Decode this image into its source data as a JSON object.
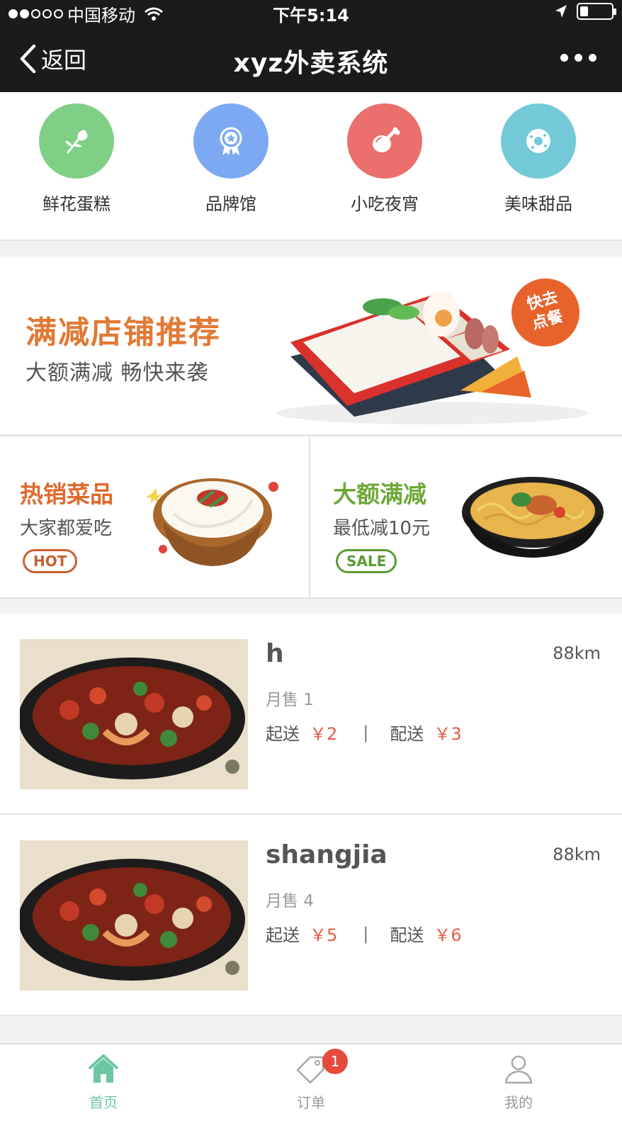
{
  "status_bar": {
    "carrier": "中国移动",
    "time": "下午5:14",
    "battery_level": 0.25
  },
  "nav": {
    "back_label": "返回",
    "title": "xyz外卖系统"
  },
  "categories": [
    {
      "label": "鲜花蛋糕",
      "icon": "flower-icon",
      "color": "#7fcf86"
    },
    {
      "label": "品牌馆",
      "icon": "award-badge-icon",
      "color": "#7da9f2"
    },
    {
      "label": "小吃夜宵",
      "icon": "drumstick-icon",
      "color": "#ea6f6d"
    },
    {
      "label": "美味甜品",
      "icon": "donut-icon",
      "color": "#74c9d8"
    }
  ],
  "banner": {
    "headline": "满减店铺推荐",
    "subline": "大额满减 畅快来袭",
    "badge": "快去\n点餐"
  },
  "promos": [
    {
      "title": "热销菜品",
      "desc": "大家都爱吃",
      "tag": "HOT"
    },
    {
      "title": "大额满减",
      "desc": "最低减10元",
      "tag": "SALE"
    }
  ],
  "shops": [
    {
      "name": "h",
      "distance": "88km",
      "monthly_sales": "月售 1",
      "min_order_label": "起送",
      "min_order": "￥2",
      "delivery_label": "配送",
      "delivery_fee": "￥3"
    },
    {
      "name": "shangjia",
      "distance": "88km",
      "monthly_sales": "月售 4",
      "min_order_label": "起送",
      "min_order": "￥5",
      "delivery_label": "配送",
      "delivery_fee": "￥6"
    }
  ],
  "tabbar": {
    "tabs": [
      {
        "label": "首页",
        "icon": "home-icon",
        "active": true
      },
      {
        "label": "订单",
        "icon": "order-tag-icon",
        "badge": "1"
      },
      {
        "label": "我的",
        "icon": "user-icon"
      }
    ],
    "active_color": "#6cc7a4"
  }
}
